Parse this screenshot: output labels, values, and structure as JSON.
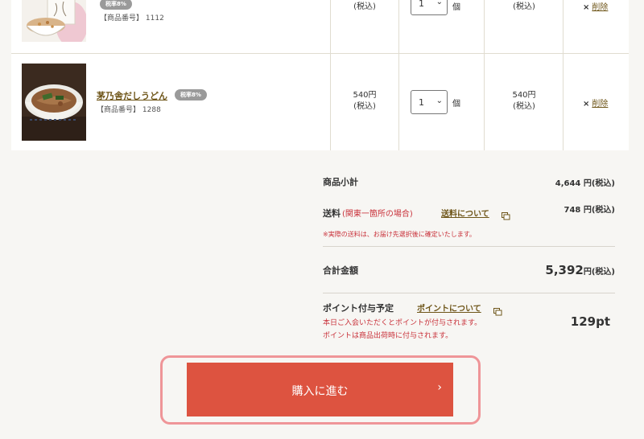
{
  "items": [
    {
      "name": "",
      "tax_badge": "税率8%",
      "code_label": "【商品番号】",
      "code": "1112",
      "price": "",
      "tax_note": "(税込)",
      "qty": "1",
      "unit": "個",
      "subtotal": "",
      "subtotal_note": "(税込)",
      "delete_label": "削除"
    },
    {
      "name": "茅乃舎だしうどん",
      "tax_badge": "税率8%",
      "code_label": "【商品番号】",
      "code": "1288",
      "price": "540円",
      "tax_note": "(税込)",
      "qty": "1",
      "unit": "個",
      "subtotal": "540円",
      "subtotal_note": "(税込)",
      "delete_label": "削除"
    }
  ],
  "summary": {
    "subtotal_label": "商品小計",
    "subtotal_value": "4,644 円(税込)",
    "shipping_label": "送料",
    "shipping_note": "(関東一箇所の場合)",
    "shipping_link": "送料について",
    "shipping_value": "748 円(税込)",
    "shipping_disclaimer": "※実際の送料は、お届け先選択後に確定いたします。",
    "total_label": "合計金額",
    "total_number": "5,392",
    "total_suffix": "円(税込)",
    "points_label": "ポイント付与予定",
    "points_link": "ポイントについて",
    "points_note1": "本日ご入会いただくとポイントが付与されます。",
    "points_note2": "ポイントは商品出荷時に付与されます。",
    "points_value": "129pt"
  },
  "checkout": {
    "label": "購入に進む",
    "chevron": "›"
  },
  "colors": {
    "accent": "#dd5340",
    "outline": "#ef9598",
    "link": "#6e5518",
    "alert": "#c9323b"
  }
}
